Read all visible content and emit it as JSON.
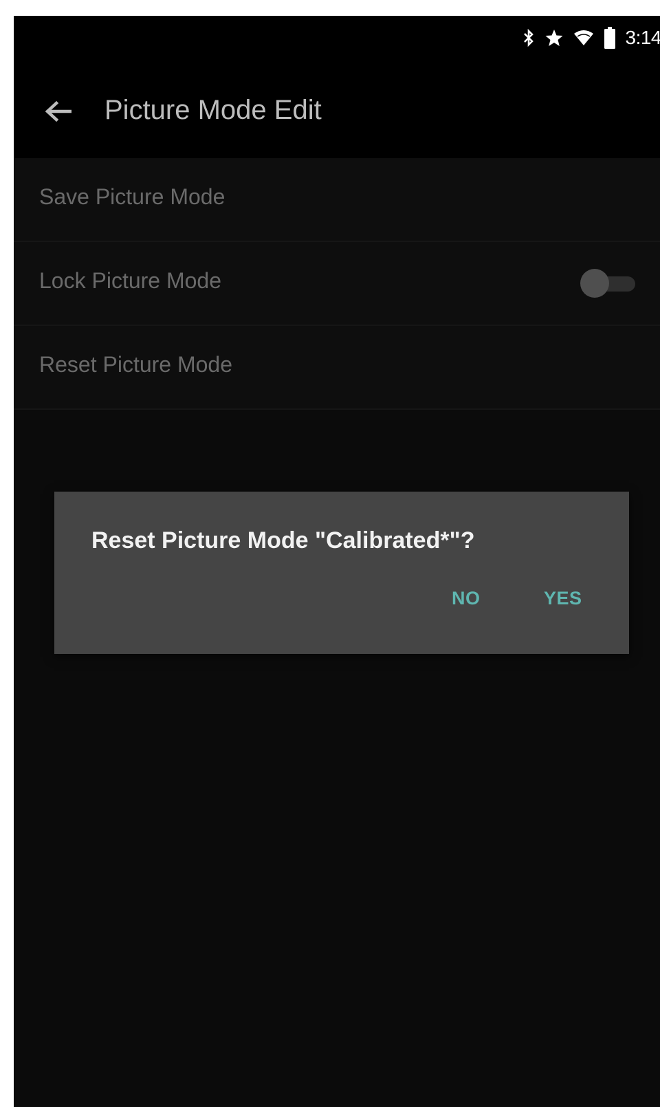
{
  "status_bar": {
    "time": "3:14",
    "icons": [
      "bluetooth-icon",
      "star-icon",
      "wifi-icon",
      "battery-icon"
    ]
  },
  "app_bar": {
    "title": "Picture Mode Edit",
    "back_icon": "arrow-left-icon"
  },
  "menu": {
    "items": [
      {
        "label": "Save Picture Mode"
      },
      {
        "label": "Lock Picture Mode",
        "toggle": false
      },
      {
        "label": "Reset Picture Mode"
      }
    ]
  },
  "dialog": {
    "message": "Reset Picture Mode \"Calibrated*\"?",
    "no_label": "NO",
    "yes_label": "YES"
  },
  "colors": {
    "background": "#0b0b0b",
    "dialog": "#454545",
    "accent": "#5fb6b0"
  }
}
